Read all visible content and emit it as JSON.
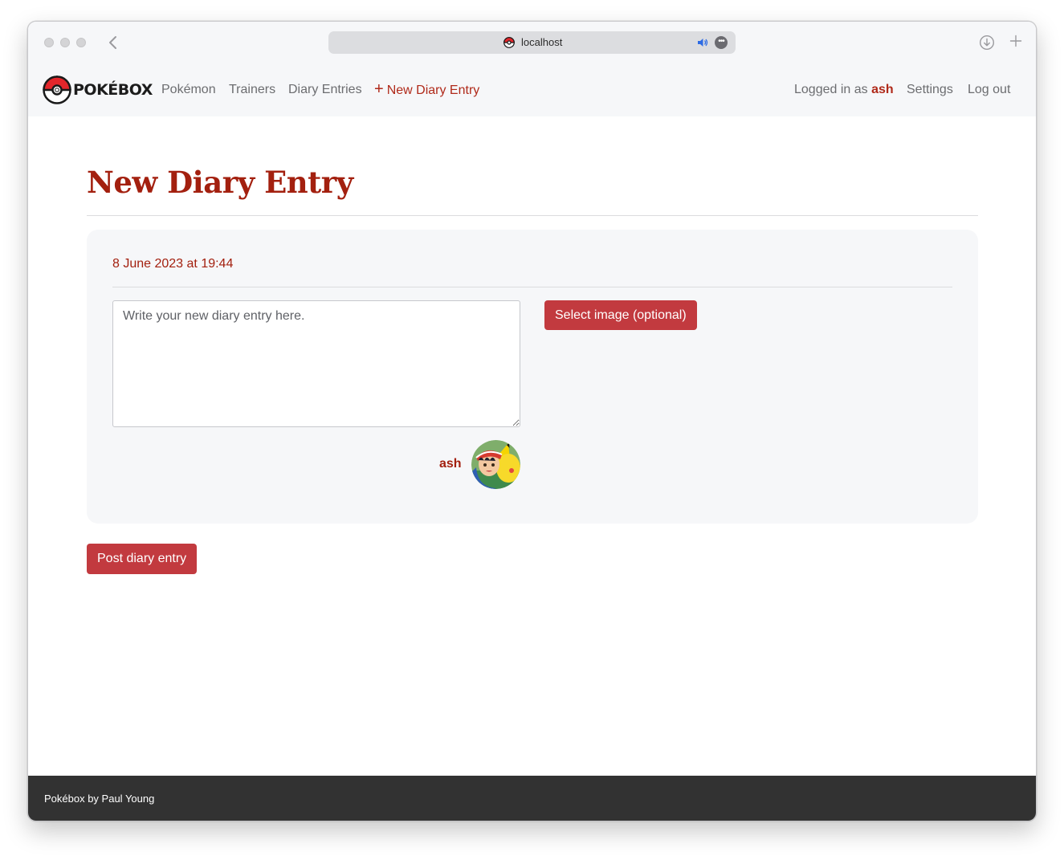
{
  "browser": {
    "url": "localhost"
  },
  "navbar": {
    "brand": "POKÉBOX",
    "links": {
      "pokemon": "Pokémon",
      "trainers": "Trainers",
      "diary_entries": "Diary Entries",
      "new_diary_entry": "New Diary Entry"
    },
    "logged_in_prefix": "Logged in as",
    "username": "ash",
    "settings": "Settings",
    "logout": "Log out"
  },
  "page": {
    "title": "New Diary Entry"
  },
  "entry": {
    "date": "8 June 2023 at 19:44",
    "text_value": "",
    "text_placeholder": "Write your new diary entry here.",
    "select_image_label": "Select image (optional)",
    "author": "ash"
  },
  "actions": {
    "post_label": "Post diary entry"
  },
  "footer": {
    "text": "Pokébox by Paul Young"
  },
  "colors": {
    "accent": "#a3200f",
    "button": "#c23a3f",
    "footer_bg": "#323232",
    "surface": "#f6f7f9"
  },
  "icons": {
    "favicon": "pokeball-icon",
    "audio": "speaker-icon",
    "more": "ellipsis-icon",
    "download": "download-icon",
    "new_tab": "plus-icon",
    "back": "chevron-left-icon"
  }
}
